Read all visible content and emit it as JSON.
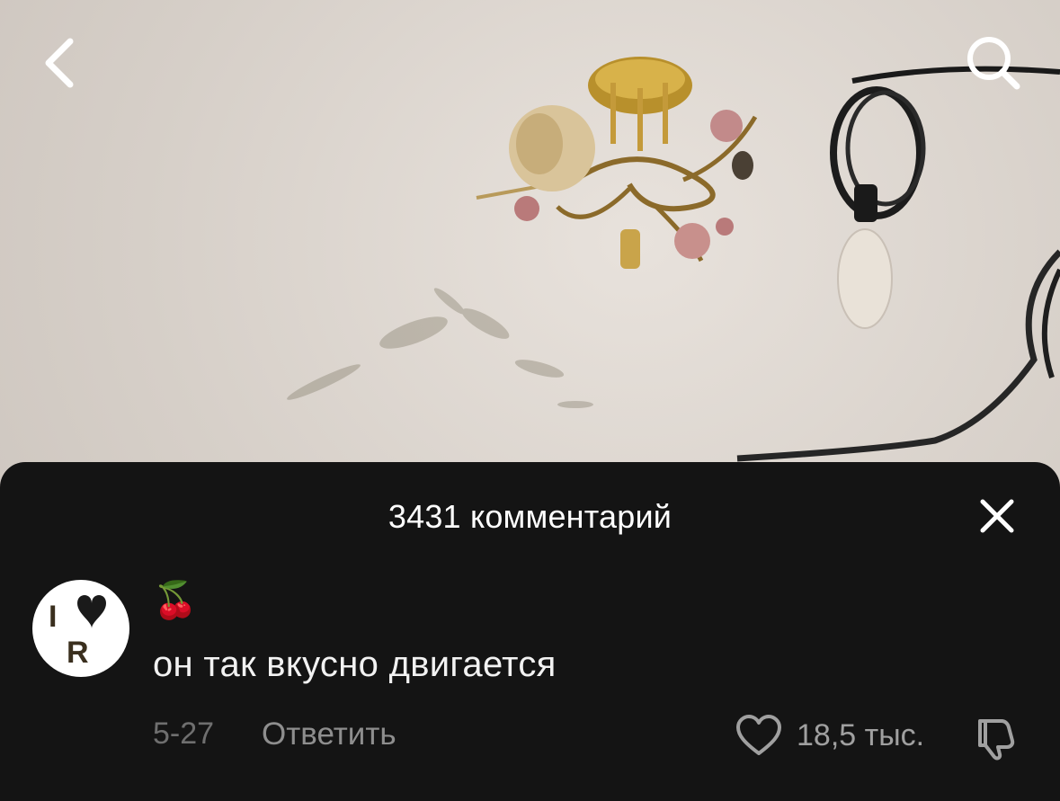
{
  "video": {
    "scene_icon": "ceiling-chandelier-image"
  },
  "nav": {
    "back_icon": "chevron-left-icon",
    "search_icon": "search-icon"
  },
  "comments": {
    "title": "3431 комментарий",
    "close_icon": "close-icon",
    "items": [
      {
        "author": "🍒",
        "text": "он так вкусно двигается",
        "date": "5-27",
        "reply_label": "Ответить",
        "like_count": "18,5 тыс.",
        "avatar_letters": [
          "I",
          "R"
        ]
      }
    ]
  },
  "colors": {
    "sheet_bg": "#141414",
    "text_primary": "#ffffff",
    "text_muted": "#8e8e8e"
  }
}
